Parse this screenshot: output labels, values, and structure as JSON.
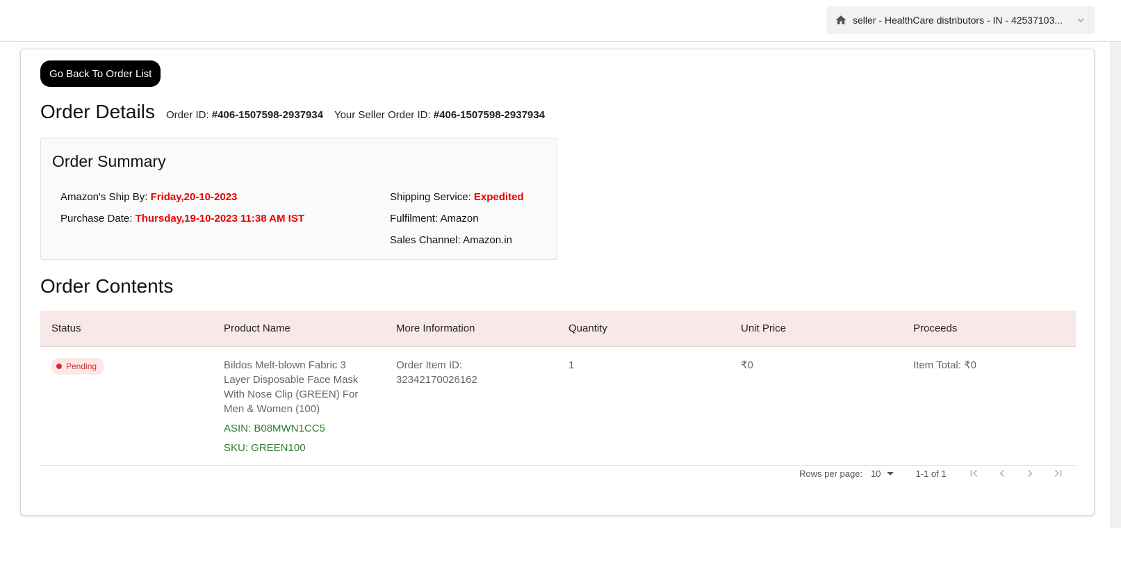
{
  "header": {
    "store_selector": "seller - HealthCare distributors - IN - 42537103..."
  },
  "back_button": "Go Back To Order List",
  "order_details": {
    "title": "Order Details",
    "order_id_label": "Order ID: ",
    "order_id": "#406-1507598-2937934",
    "seller_order_id_label": "Your Seller Order ID: ",
    "seller_order_id": "#406-1507598-2937934"
  },
  "summary": {
    "title": "Order Summary",
    "ship_by_label": "Amazon's Ship By: ",
    "ship_by": "Friday,20-10-2023",
    "purchase_date_label": "Purchase Date: ",
    "purchase_date": "Thursday,19-10-2023 11:38 AM IST",
    "shipping_service_label": "Shipping Service: ",
    "shipping_service": "Expedited",
    "fulfilment_label": "Fulfilment: ",
    "fulfilment": "Amazon",
    "sales_channel_label": "Sales Channel: ",
    "sales_channel": "Amazon.in"
  },
  "contents": {
    "title": "Order Contents",
    "columns": [
      "Status",
      "Product Name",
      "More Information",
      "Quantity",
      "Unit Price",
      "Proceeds"
    ],
    "rows": [
      {
        "status": "Pending",
        "product_name": "Bildos Melt-blown Fabric 3 Layer Disposable Face Mask With Nose Clip (GREEN) For Men & Women (100)",
        "asin": "ASIN: B08MWN1CC5",
        "sku": "SKU: GREEN100",
        "more_info_label": "Order Item ID:",
        "more_info_value": "32342170026162",
        "quantity": "1",
        "unit_price": "₹0",
        "proceeds": "Item Total: ₹0"
      }
    ]
  },
  "pagination": {
    "rows_per_page_label": "Rows per page:",
    "rows_per_page": "10",
    "range": "1-1 of 1"
  },
  "colors": {
    "accent_red": "#ee0000",
    "sku_green": "#2e7d32",
    "header_row_bg": "#f9e8e8"
  }
}
